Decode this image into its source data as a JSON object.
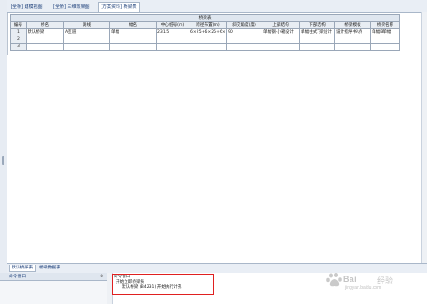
{
  "tabs": [
    {
      "label": "[全桥] 建模视图",
      "active": false
    },
    {
      "label": "[全桥] 三维效果图",
      "active": false
    },
    {
      "label": "[方案资料] 桥梁表",
      "active": true
    }
  ],
  "grid": {
    "title": "桥梁表",
    "columns": [
      "编号",
      "桥名",
      "路线",
      "幅名",
      "中心桩号(m)",
      "跨径布置(m)",
      "斜交角度(度)",
      "上部结构",
      "下部结构",
      "桥梁模板",
      "桥梁名称"
    ],
    "rows": [
      {
        "num": "1",
        "cells": [
          "默认桥梁",
          "A匝道",
          "单幅",
          "231.5",
          "6×25+6×25+6×2",
          "90",
          "单幅钢-小箱设计",
          "单幅柱式T梁设计",
          "设计指导书\\桥",
          "单幅B单幅"
        ]
      },
      {
        "num": "2",
        "cells": [
          "",
          "",
          "",
          "",
          "",
          "",
          "",
          "",
          "",
          ""
        ]
      },
      {
        "num": "3",
        "cells": [
          "",
          "",
          "",
          "",
          "",
          "",
          "",
          "",
          "",
          ""
        ]
      }
    ]
  },
  "bottom_tabs": [
    {
      "label": "默认桥梁表",
      "active": true
    },
    {
      "label": "桥梁数据表",
      "active": false
    }
  ],
  "panel": {
    "title": "命令窗口",
    "pin": "⊕",
    "tree": [
      "命令窗口",
      "开始立即桥梁表",
      "默认桥梁 (B4231) 开始执行计孔"
    ]
  },
  "watermark": {
    "brand": "Bai",
    "brand2": "经验",
    "url": "jingyan.baidu.com"
  }
}
